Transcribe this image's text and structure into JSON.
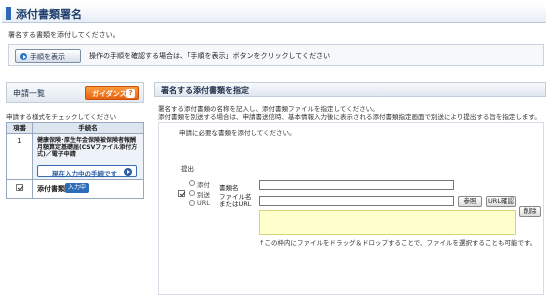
{
  "header": {
    "title": "添付書類署名"
  },
  "intro": "署名する書類を添付してください。",
  "help": {
    "button_label": "手順を表示",
    "text": "操作の手順を確認する場合は、「手順を表示」ボタンをクリックしてください"
  },
  "left_panel": {
    "title": "申請一覧",
    "guidance_label": "ガイダンス",
    "guidance_icon": "?",
    "note": "申請する様式をチェックしてください",
    "table": {
      "headers": [
        "項番",
        "手続名"
      ],
      "rows": [
        {
          "number": "1",
          "procedure_name": "健康保険･厚生年金保険被保険者報酬月額算定基礎届(CSVファイル添付方式)／電子申請",
          "current_button": "現在入力中の手続です"
        }
      ],
      "attachment_row": {
        "label": "添付書類",
        "badge": "入力中",
        "checked": true
      }
    }
  },
  "right_panel": {
    "title": "署名する添付書類を指定",
    "desc1": "署名する添付書類の名称を記入し、添付書類ファイルを指定してください。",
    "desc2": "添付書類を別送する場合は、申請書送信時、基本情報入力後に表示される添付書類指定画面で別送により提出する旨を指定します。",
    "box_label": "申請に必要な書類を添付してください。",
    "submit_label": "提出",
    "options": [
      "添付",
      "別送",
      "URL"
    ],
    "row_checked": true,
    "fields": {
      "name_label": "書類名",
      "file_label_line1": "ファイル名",
      "file_label_line2": "またはURL"
    },
    "buttons": {
      "browse": "参照",
      "url_check": "URL確認",
      "delete": "削除"
    },
    "drop_note": "↑この枠内にファイルをドラッグ＆ドロップすることで、ファイルを選択することも可能です。"
  }
}
